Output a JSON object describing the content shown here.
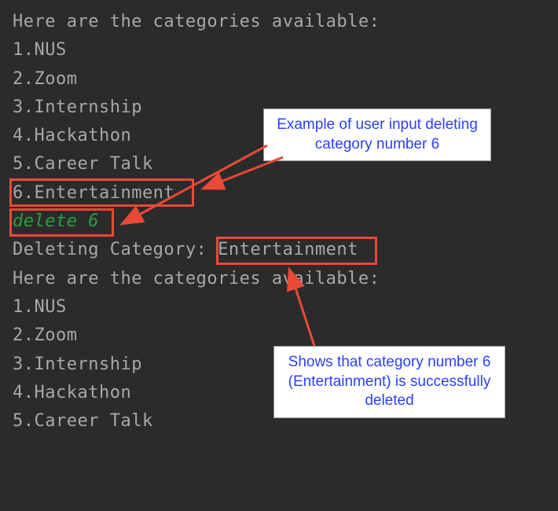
{
  "terminal": {
    "header1": "Here are the categories available:",
    "list1": [
      "1.NUS",
      "2.Zoom",
      "3.Internship",
      "4.Hackathon",
      "5.Career Talk",
      "6.Entertainment"
    ],
    "command": "delete 6",
    "deleting_prefix": "Deleting Category: ",
    "deleting_name": "Entertainment",
    "header2": "Here are the categories available:",
    "list2": [
      "1.NUS",
      "2.Zoom",
      "3.Internship",
      "4.Hackathon",
      "5.Career Talk"
    ]
  },
  "annotations": {
    "callout1": "Example of user input deleting category number 6",
    "callout2": "Shows that category number 6 (Entertainment) is successfully deleted"
  },
  "colors": {
    "terminal_bg": "#2b2b2b",
    "terminal_text": "#a8a8a8",
    "command_text": "#2e9e3f",
    "highlight_border": "#e84a36",
    "callout_text": "#2a3fff",
    "callout_bg": "#ffffff"
  }
}
